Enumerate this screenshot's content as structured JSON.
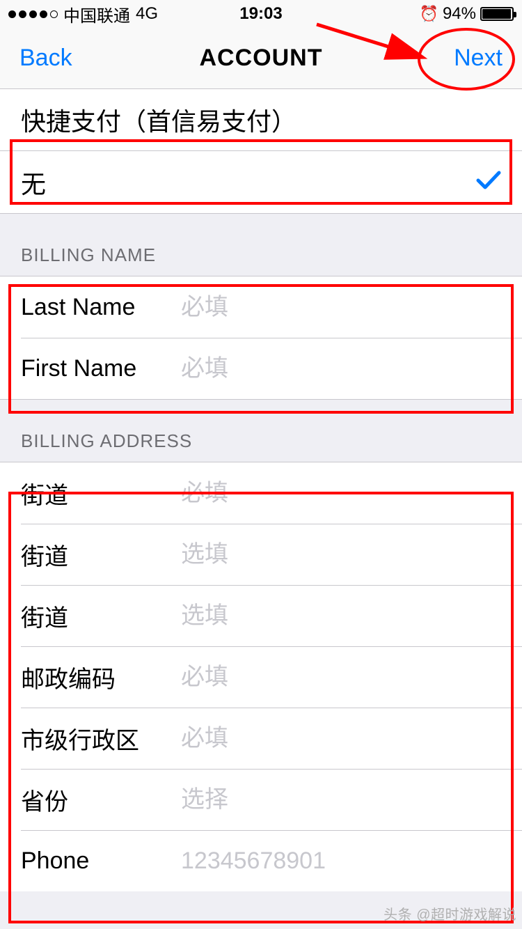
{
  "status": {
    "carrier": "中国联通",
    "network": "4G",
    "time": "19:03",
    "battery_pct": "94%"
  },
  "nav": {
    "back": "Back",
    "title": "ACCOUNT",
    "next": "Next"
  },
  "payment": {
    "method": "快捷支付（首信易支付）",
    "selected": "无"
  },
  "billing_name": {
    "header": "BILLING NAME",
    "last_label": "Last Name",
    "last_placeholder": "必填",
    "first_label": "First Name",
    "first_placeholder": "必填"
  },
  "billing_address": {
    "header": "BILLING ADDRESS",
    "street1_label": "街道",
    "street1_placeholder": "必填",
    "street2_label": "街道",
    "street2_placeholder": "选填",
    "street3_label": "街道",
    "street3_placeholder": "选填",
    "postal_label": "邮政编码",
    "postal_placeholder": "必填",
    "city_label": "市级行政区",
    "city_placeholder": "必填",
    "province_label": "省份",
    "province_placeholder": "选择",
    "phone_label": "Phone",
    "phone_placeholder": "12345678901"
  },
  "watermark": "头条 @超时游戏解说"
}
